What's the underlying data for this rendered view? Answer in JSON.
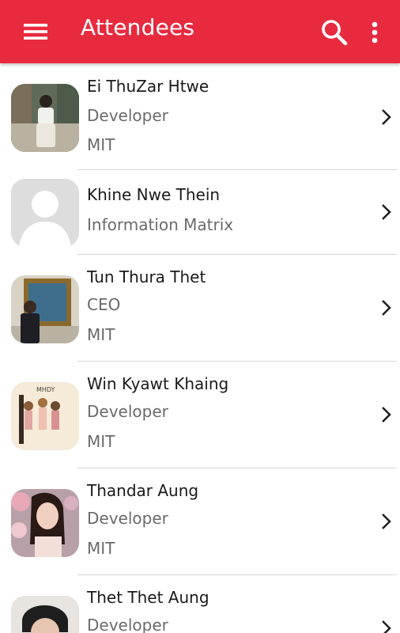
{
  "appbar": {
    "title": "Attendees",
    "icons": [
      "menu-icon",
      "search-icon",
      "more-vert-icon"
    ],
    "color": "#e82a3f"
  },
  "attendees": [
    {
      "name": "Ei ThuZar Htwe",
      "role": "Developer",
      "company": "MIT"
    },
    {
      "name": "Khine Nwe Thein",
      "role": "Information Matrix",
      "company": ""
    },
    {
      "name": "Tun Thura Thet",
      "role": "CEO",
      "company": "MIT"
    },
    {
      "name": "Win Kyawt Khaing",
      "role": "Developer",
      "company": "MIT"
    },
    {
      "name": "Thandar Aung",
      "role": "Developer",
      "company": "MIT"
    },
    {
      "name": "Thet Thet Aung",
      "role": "Developer",
      "company": ""
    }
  ]
}
